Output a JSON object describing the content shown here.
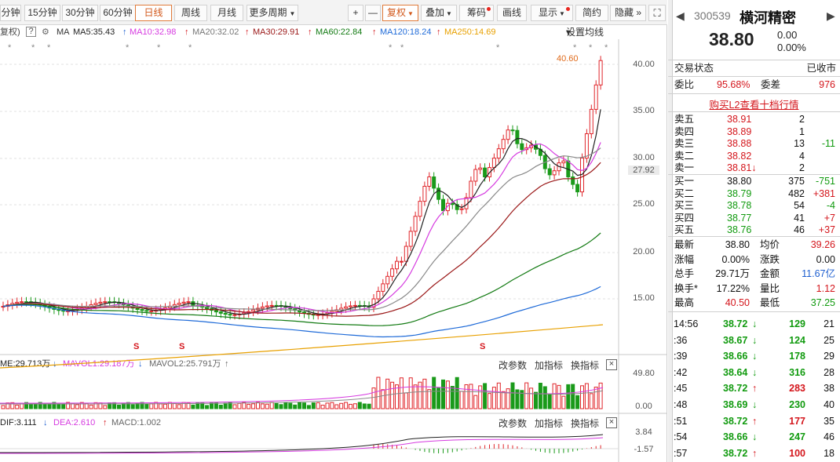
{
  "toolbar": {
    "periods": [
      "分钟",
      "15分钟",
      "30分钟",
      "60分钟",
      "日线",
      "周线",
      "月线",
      "更多周期"
    ],
    "active_period": "日线",
    "zoom_in": "+",
    "zoom_out": "—",
    "fuquan": "复权",
    "overlay": "叠加",
    "chips": "筹码",
    "draw": "画线",
    "display": "显示",
    "simple": "简约",
    "hide": "隐藏",
    "more": "»"
  },
  "ma_row": {
    "fuquan_tag": "复权)",
    "help": "?",
    "ma_label": "MA",
    "ma5": "MA5:35.43",
    "ma10": "MA10:32.98",
    "ma20": "MA20:32.02",
    "ma30": "MA30:29.91",
    "ma60": "MA60:22.84",
    "ma120": "MA120:18.24",
    "ma250": "MA250:14.69",
    "settings": "设置均线",
    "colors": {
      "ma5": "#222222",
      "ma10": "#d63be0",
      "ma20": "#888888",
      "ma30": "#9a1717",
      "ma60": "#127a12",
      "ma120": "#1e6ad8",
      "ma250": "#e8a000"
    }
  },
  "main_chart": {
    "high_marker": "40.60",
    "axis": [
      "40.00",
      "35.00",
      "30.00",
      "25.00",
      "20.00",
      "15.00"
    ],
    "current_price_tag": "27.92",
    "event_marker": "S"
  },
  "volume_panel": {
    "vol": "ME:29.713万",
    "mavol1": "MAVOL1:29.187万",
    "mavol2": "MAVOL2:25.791万",
    "axis_top": "49.80",
    "axis_bottom": "0.00",
    "btn_params": "改参数",
    "btn_add": "加指标",
    "btn_switch": "换指标",
    "close": "×"
  },
  "macd_panel": {
    "dif": "DIF:3.111",
    "dea": "DEA:2.610",
    "macd": "MACD:1.002",
    "axis_top": "3.84",
    "axis_bottom": "-1.57",
    "btn_params": "改参数",
    "btn_add": "加指标",
    "btn_switch": "换指标",
    "close": "×"
  },
  "quote": {
    "code": "300539",
    "name": "横河精密",
    "price": "38.80",
    "change": "0.00",
    "change_pct": "0.00%",
    "status_label": "交易状态",
    "status_value": "已收市",
    "weibi_label": "委比",
    "weibi_value": "95.68%",
    "weicha_label": "委差",
    "weicha_value": "976",
    "l2_link": "购买L2查看十档行情",
    "asks": [
      {
        "label": "卖五",
        "price": "38.91",
        "vol": "2",
        "chg": ""
      },
      {
        "label": "卖四",
        "price": "38.89",
        "vol": "1",
        "chg": ""
      },
      {
        "label": "卖三",
        "price": "38.88",
        "vol": "13",
        "chg": "-11"
      },
      {
        "label": "卖二",
        "price": "38.82",
        "vol": "4",
        "chg": ""
      },
      {
        "label": "卖一",
        "price": "38.81↓",
        "vol": "2",
        "chg": ""
      }
    ],
    "bids": [
      {
        "label": "买一",
        "price": "38.80",
        "vol": "375",
        "chg": "-751"
      },
      {
        "label": "买二",
        "price": "38.79",
        "vol": "482",
        "chg": "+381"
      },
      {
        "label": "买三",
        "price": "38.78",
        "vol": "54",
        "chg": "-4"
      },
      {
        "label": "买四",
        "price": "38.77",
        "vol": "41",
        "chg": "+7"
      },
      {
        "label": "买五",
        "price": "38.76",
        "vol": "46",
        "chg": "+37"
      }
    ],
    "stats": [
      {
        "l1": "最新",
        "v1": "38.80",
        "l2": "均价",
        "v2": "39.26"
      },
      {
        "l1": "涨幅",
        "v1": "0.00%",
        "l2": "涨跌",
        "v2": "0.00"
      },
      {
        "l1": "总手",
        "v1": "29.71万",
        "l2": "金额",
        "v2": "11.67亿"
      },
      {
        "l1": "换手*",
        "v1": "17.22%",
        "l2": "量比",
        "v2": "1.12"
      },
      {
        "l1": "最高",
        "v1": "40.50",
        "l2": "最低",
        "v2": "37.25"
      }
    ],
    "ticks": [
      {
        "time": "14:56",
        "price": "38.72",
        "dir": "↓",
        "vol": "129",
        "num": "21"
      },
      {
        "time": ":36",
        "price": "38.67",
        "dir": "↓",
        "vol": "124",
        "num": "25"
      },
      {
        "time": ":39",
        "price": "38.66",
        "dir": "↓",
        "vol": "178",
        "num": "29"
      },
      {
        "time": ":42",
        "price": "38.64",
        "dir": "↓",
        "vol": "316",
        "num": "28"
      },
      {
        "time": ":45",
        "price": "38.72",
        "dir": "↑",
        "vol": "283",
        "num": "38"
      },
      {
        "time": ":48",
        "price": "38.69",
        "dir": "↓",
        "vol": "230",
        "num": "40"
      },
      {
        "time": ":51",
        "price": "38.72",
        "dir": "↑",
        "vol": "177",
        "num": "35"
      },
      {
        "time": ":54",
        "price": "38.66",
        "dir": "↓",
        "vol": "247",
        "num": "46"
      },
      {
        "time": ":57",
        "price": "38.72",
        "dir": "↑",
        "vol": "100",
        "num": "18"
      }
    ]
  }
}
